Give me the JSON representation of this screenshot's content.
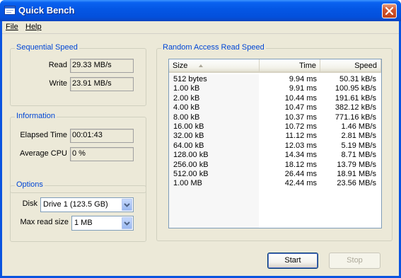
{
  "window": {
    "title": "Quick Bench",
    "close_symbol": "✕"
  },
  "menu": {
    "file": "File",
    "help": "Help"
  },
  "sequential": {
    "group_title": "Sequential Speed",
    "read_label": "Read",
    "read_value": "29.33 MB/s",
    "write_label": "Write",
    "write_value": "23.91 MB/s"
  },
  "information": {
    "group_title": "Information",
    "elapsed_label": "Elapsed Time",
    "elapsed_value": "00:01:43",
    "cpu_label": "Average CPU",
    "cpu_value": "0 %"
  },
  "options": {
    "group_title": "Options",
    "disk_label": "Disk",
    "disk_value": "Drive 1 (123.5 GB)",
    "max_read_label": "Max read size",
    "max_read_value": "1 MB"
  },
  "random_access": {
    "group_title": "Random Access Read Speed",
    "columns": [
      "Size",
      "Time",
      "Speed"
    ],
    "rows": [
      {
        "size": "512 bytes",
        "time": "9.94 ms",
        "speed": "50.31 kB/s"
      },
      {
        "size": "1.00 kB",
        "time": "9.91 ms",
        "speed": "100.95 kB/s"
      },
      {
        "size": "2.00 kB",
        "time": "10.44 ms",
        "speed": "191.61 kB/s"
      },
      {
        "size": "4.00 kB",
        "time": "10.47 ms",
        "speed": "382.12 kB/s"
      },
      {
        "size": "8.00 kB",
        "time": "10.37 ms",
        "speed": "771.16 kB/s"
      },
      {
        "size": "16.00 kB",
        "time": "10.72 ms",
        "speed": "1.46 MB/s"
      },
      {
        "size": "32.00 kB",
        "time": "11.12 ms",
        "speed": "2.81 MB/s"
      },
      {
        "size": "64.00 kB",
        "time": "12.03 ms",
        "speed": "5.19 MB/s"
      },
      {
        "size": "128.00 kB",
        "time": "14.34 ms",
        "speed": "8.71 MB/s"
      },
      {
        "size": "256.00 kB",
        "time": "18.12 ms",
        "speed": "13.79 MB/s"
      },
      {
        "size": "512.00 kB",
        "time": "26.44 ms",
        "speed": "18.91 MB/s"
      },
      {
        "size": "1.00 MB",
        "time": "42.44 ms",
        "speed": "23.56 MB/s"
      }
    ]
  },
  "buttons": {
    "start": "Start",
    "stop": "Stop"
  },
  "colors": {
    "title_bar": "#0a62f0",
    "group_title": "#0046d5",
    "dialog_bg": "#ece9d8",
    "close_button": "#d0542d"
  },
  "icons": {
    "app": "app-window-icon",
    "close": "close-icon",
    "sort": "sort-ascending-icon",
    "dropdown": "chevron-down-icon"
  }
}
